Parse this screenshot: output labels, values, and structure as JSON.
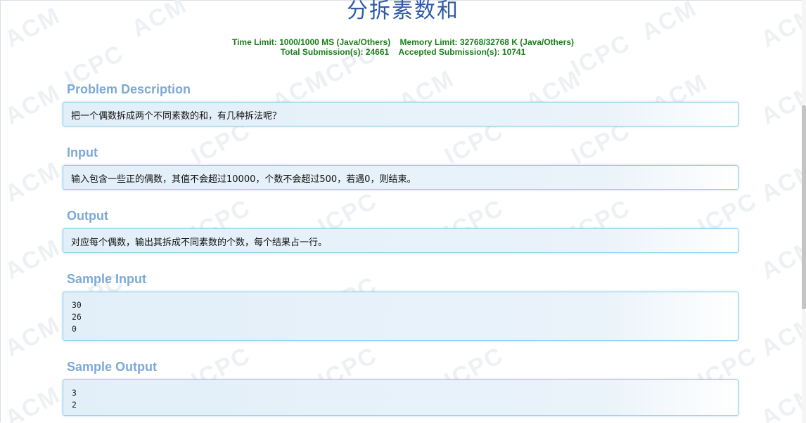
{
  "problem": {
    "title": "分拆素数和",
    "time_limit": "Time Limit: 1000/1000 MS (Java/Others)",
    "memory_limit": "Memory Limit: 32768/32768 K (Java/Others)",
    "total_submissions": "Total Submission(s): 24661",
    "accepted_submissions": "Accepted Submission(s): 10741"
  },
  "sections": {
    "description": {
      "heading": "Problem Description",
      "text": "把一个偶数拆成两个不同素数的和，有几种拆法呢？"
    },
    "input": {
      "heading": "Input",
      "text": "输入包含一些正的偶数，其值不会超过10000，个数不会超过500，若遇0，则结束。"
    },
    "output": {
      "heading": "Output",
      "text": "对应每个偶数，输出其拆成不同素数的个数，每个结果占一行。"
    },
    "sample_input": {
      "heading": "Sample Input",
      "text": "30\n26\n0"
    },
    "sample_output": {
      "heading": "Sample Output",
      "text": "3\n2"
    }
  },
  "watermark": {
    "text_a": "ACM",
    "text_b": "ICPC"
  }
}
